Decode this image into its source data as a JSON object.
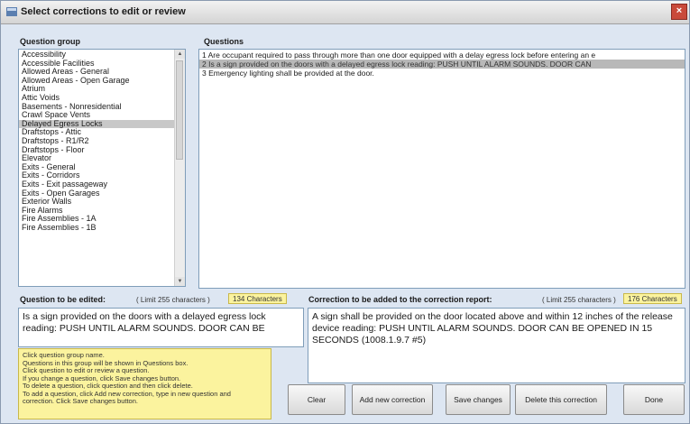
{
  "window": {
    "title": "Select corrections to edit or review",
    "close_glyph": "×",
    "icon": "app-icon"
  },
  "question_group": {
    "label": "Question group",
    "items": [
      "Accessibility",
      "Accessible Facilities",
      "Allowed Areas - General",
      "Allowed Areas - Open Garage",
      "Atrium",
      "Attic Voids",
      "Basements - Nonresidential",
      "Crawl Space Vents",
      "Delayed Egress Locks",
      "Draftstops - Attic",
      "Draftstops - R1/R2",
      "Draftstops - Floor",
      "Elevator",
      "Exits - General",
      "Exits - Corridors",
      "Exits - Exit passageway",
      "Exits - Open Garages",
      "Exterior Walls",
      "Fire Alarms",
      "Fire Assemblies - 1A",
      "Fire Assemblies - 1B"
    ],
    "selected_index": 8
  },
  "questions": {
    "label": "Questions",
    "items": [
      "1  Are occupant required to pass through more than one door equipped with a delay egress lock before entering an e",
      "2  Is a sign provided on the doors with a delayed egress lock reading: PUSH UNTIL ALARM SOUNDS. DOOR CAN",
      "3  Emergency lighting shall be provided at the door."
    ],
    "selected_index": 1
  },
  "question_edit": {
    "label": "Question to be edited:",
    "limit": "( Limit 255 characters )",
    "count": "134 Characters",
    "value": "Is a sign provided on the doors with a delayed egress lock reading: PUSH UNTIL ALARM SOUNDS. DOOR CAN BE"
  },
  "correction_edit": {
    "label": "Correction to be added to the correction report:",
    "limit": "( Limit 255 characters )",
    "count": "176 Characters",
    "value": "A sign shall be provided on the door located above and within 12 inches of the release device reading: PUSH UNTIL ALARM SOUNDS. DOOR CAN BE OPENED IN 15 SECONDS (1008.1.9.7 #5)"
  },
  "help_text": [
    "Click question group name.",
    "Questions in this group will be shown in Questions box.",
    "Click question to edit or review a question.",
    "If you change a question, click Save changes button.",
    "To delete a question, click question and then click delete.",
    "To add a question, click Add new correction, type in new question and",
    "correction. Click Save changes button."
  ],
  "buttons": {
    "clear": "Clear",
    "add_new": "Add new correction",
    "save": "Save changes",
    "delete": "Delete this correction",
    "done": "Done"
  }
}
